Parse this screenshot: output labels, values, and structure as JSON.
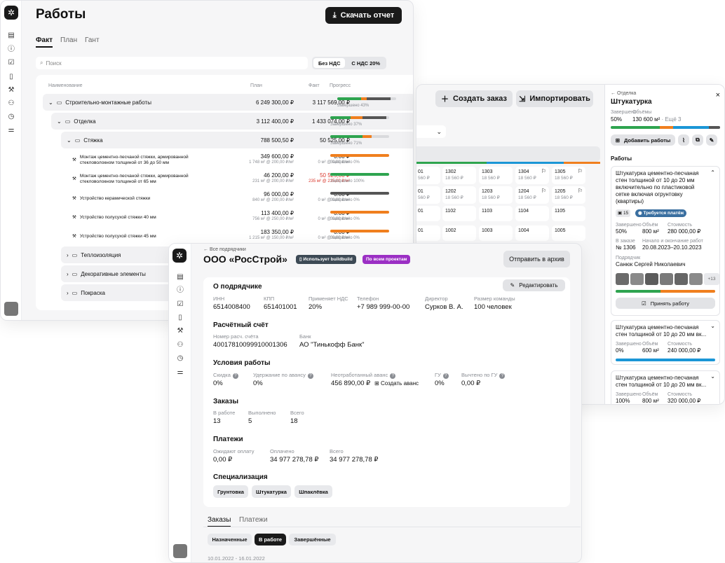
{
  "works": {
    "title": "Работы",
    "download_label": "Скачать отчет",
    "tabs": [
      "Факт",
      "План",
      "Гант"
    ],
    "search_placeholder": "Поиск",
    "vat_toggle": [
      "Без НДС",
      "С НДС 20%"
    ],
    "columns": {
      "name": "Наименование",
      "plan": "План",
      "fact": "Факт",
      "progress": "Прогресс"
    },
    "rows": [
      {
        "name": "Строительно-монтажные работы",
        "plan": "6 249 300,00 ₽",
        "fact": "3 117 569,00 ₽",
        "progress": "Завершено 43%",
        "completed": 0.43
      },
      {
        "name": "Отделка",
        "plan": "3 112 400,00 ₽",
        "fact": "1 433 074,00 ₽",
        "progress": "Завершено 37%",
        "completed": 0.37
      },
      {
        "name": "Стяжка",
        "plan": "788 500,50 ₽",
        "fact": "50 525,00 ₽",
        "progress": "Завершено 71%",
        "completed": 0.71
      },
      {
        "name": "Монтаж цементно-песчаной стяжки, армированной стекловолокном толщиной от 36 до 50 мм",
        "plan": "349 600,00 ₽",
        "plan_sub": "1 748 м² @ 200,00 ₽/м²",
        "fact": "0.00 ₽",
        "fact_sub": "0 м² @ 0,00 ₽/м²",
        "progress": "Завершено 0%",
        "completed": 0
      },
      {
        "name": "Монтаж цементно-песчаной стяжки, армированной стекловолокном толщиной от 65 мм",
        "plan": "46 200,00 ₽",
        "plan_sub": "231 м² @ 200,00 ₽/м²",
        "fact": "50 525,00 ₽",
        "fact_sub": "235 м² @ 215,00 ₽/м²",
        "progress": "Завершено 100%",
        "completed": 1.0
      },
      {
        "name": "Устройство керамической стяжки",
        "plan": "96 000,00 ₽",
        "plan_sub": "840 м² @ 200,00 ₽/м²",
        "fact": "0.00 ₽",
        "fact_sub": "0 м² @ 0,00 ₽/м²",
        "progress": "Завершено 0%",
        "completed": 0
      },
      {
        "name": "Устройство полусухой стяжки 40 мм",
        "plan": "113 400,00 ₽",
        "plan_sub": "756 м² @ 250,00 ₽/м²",
        "fact": "0.00 ₽",
        "fact_sub": "0 м² @ 0,00 ₽/м²",
        "progress": "Завершено 0%",
        "completed": 0
      },
      {
        "name": "Устройство полусухой стяжки 45 мм",
        "plan": "183 350,00 ₽",
        "plan_sub": "1 215 м² @ 150,00 ₽/м²",
        "fact": "0.00 ₽",
        "fact_sub": "0 м² @ 0,00 ₽/м²",
        "progress": "Завершено 0%",
        "completed": 0
      },
      {
        "name": "Теплоизоляция"
      },
      {
        "name": "Декоративные элементы"
      },
      {
        "name": "Покраска"
      }
    ]
  },
  "orders": {
    "create_label": "Создать заказ",
    "import_label": "Импортировать",
    "grid": [
      [
        "01",
        "1302",
        "1303",
        "1304",
        "1305"
      ],
      [
        "01",
        "1202",
        "1203",
        "1204",
        "1205"
      ],
      [
        "01",
        "1102",
        "1103",
        "1104",
        "1105"
      ],
      [
        "01",
        "1002",
        "1003",
        "1004",
        "1005"
      ]
    ],
    "cell_price": "18 560 ₽",
    "cell_price_partial": "560 ₽"
  },
  "detail": {
    "back": "← Отделка",
    "title": "Штукатурка",
    "completed_label": "Завершено",
    "completed_value": "50%",
    "volume_label": "Объёмы",
    "volume_value": "130 600 м²",
    "volume_more": "· Ещё 3",
    "add_works": "Добавить работы",
    "section": "Работы",
    "cards": [
      {
        "title": "Штукатурка цементно-песчаная стен толщиной от 10 до 20 мм включительно по пластиковой сетке включая огрунтовку (квартиры)",
        "photos": "15",
        "badge": "Требуется платёж",
        "done_label": "Завершено",
        "done": "50%",
        "vol_label": "Объём",
        "vol": "800 м²",
        "cost_label": "Стоимость",
        "cost": "280 000,00 ₽",
        "order_label": "В заказе",
        "order": "№ 1306",
        "dates_label": "Начало и окончание работ",
        "dates": "20.08.2023–20.10.2023",
        "contractor_label": "Подрядчик",
        "contractor": "Санюк Сергей Николаевич",
        "more": "+13",
        "accept": "Принять работу"
      },
      {
        "title": "Штукатурка цементно-песчаная стен толщиной от 10 до 20 мм вк...",
        "done_label": "Завершено",
        "done": "0%",
        "vol_label": "Объём",
        "vol": "600 м²",
        "cost_label": "Стоимость",
        "cost": "240 000,00 ₽"
      },
      {
        "title": "Штукатурка цементно-песчаная стен толщиной от 10 до 20 мм вк...",
        "done_label": "Завершено",
        "done": "100%",
        "vol_label": "Объём",
        "vol": "800 м²",
        "cost_label": "Стоимость",
        "cost": "320 000,00 ₽"
      }
    ]
  },
  "contractor": {
    "back": "← Все подрядчики",
    "name": "ООО «РосСтрой»",
    "tag_uses": "Использует buildbuild",
    "tag_all": "По всем проектам",
    "archive": "Отправить в архив",
    "edit": "Редактировать",
    "about": {
      "title": "О подрядчике",
      "fields": [
        {
          "label": "ИНН",
          "value": "6514008400"
        },
        {
          "label": "КПП",
          "value": "651401001"
        },
        {
          "label": "Применяет НДС",
          "value": "20%"
        },
        {
          "label": "Телефон",
          "value": "+7 989 999-00-00"
        },
        {
          "label": "Директор",
          "value": "Сурков В. А."
        },
        {
          "label": "Размер команды",
          "value": "100 человек"
        }
      ]
    },
    "account": {
      "title": "Расчётный счёт",
      "fields": [
        {
          "label": "Номер расч. счёта",
          "value": "40017810099910001306"
        },
        {
          "label": "Банк",
          "value": "АО \"Тинькофф Банк\""
        }
      ]
    },
    "terms": {
      "title": "Условия работы",
      "fields": [
        {
          "label": "Скидка",
          "value": "0%"
        },
        {
          "label": "Удержание по авансу",
          "value": "0%"
        },
        {
          "label": "Неотработанный аванс",
          "value": "456 890,00 ₽"
        },
        {
          "label": "ГУ",
          "value": "0%"
        },
        {
          "label": "Вычтено по ГУ",
          "value": "0,00 ₽"
        }
      ],
      "create_advance": "Создать аванс"
    },
    "orders": {
      "title": "Заказы",
      "fields": [
        {
          "label": "В работе",
          "value": "13"
        },
        {
          "label": "Выполнено",
          "value": "5"
        },
        {
          "label": "Всего",
          "value": "18"
        }
      ]
    },
    "payments": {
      "title": "Платежи",
      "fields": [
        {
          "label": "Ожидают оплату",
          "value": "0,00 ₽"
        },
        {
          "label": "Оплачено",
          "value": "34 977 278,78 ₽"
        },
        {
          "label": "Всего",
          "value": "34 977 278,78 ₽"
        }
      ]
    },
    "specialization": {
      "title": "Специализация",
      "chips": [
        "Грунтовка",
        "Штукатурка",
        "Шпаклёвка"
      ]
    },
    "bottom_tabs": [
      "Заказы",
      "Платежи"
    ],
    "filters": [
      "Назначенные",
      "В работе",
      "Завершённые"
    ],
    "date_range": "10.01.2022 - 16.01.2022"
  },
  "colors": {
    "accent_dark": "#1a1a1a",
    "green": "#2ea44f",
    "orange": "#f07f1e",
    "blue": "#1b96d6",
    "purple": "#9b2fc4",
    "badge_blue": "#3a6fa0"
  }
}
